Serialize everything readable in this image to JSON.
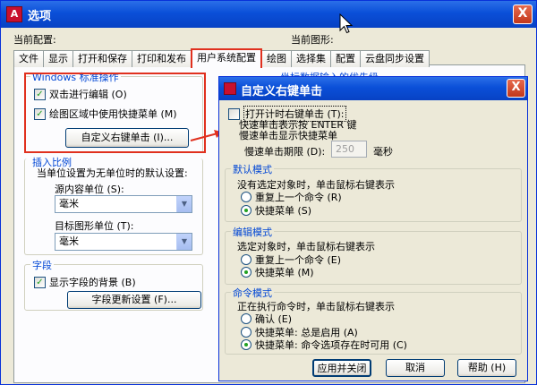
{
  "window": {
    "title": "选项",
    "close_label": "X",
    "app_icon_text": "A"
  },
  "profile": {
    "current_config_label": "当前配置:",
    "current_drawing_label": "当前图形:"
  },
  "tabs": [
    "文件",
    "显示",
    "打开和保存",
    "打印和发布",
    "用户系统配置",
    "绘图",
    "选择集",
    "配置",
    "云盘同步设置"
  ],
  "windows_group": {
    "title": "Windows 标准操作",
    "double_click_edit": "双击进行编辑 (O)",
    "shortcut_menu_in_drawing": "绘图区域中使用快捷菜单 (M)",
    "custom_right_click_button": "自定义右键单击 (I)..."
  },
  "insert_scale": {
    "title": "插入比例",
    "description": "当单位设置为无单位时的默认设置:",
    "source_units_label": "源内容单位 (S):",
    "source_units_value": "毫米",
    "target_units_label": "目标图形单位 (T):",
    "target_units_value": "毫米"
  },
  "fields": {
    "title": "字段",
    "show_background": "显示字段的背景 (B)",
    "update_settings_button": "字段更新设置 (F)..."
  },
  "background_text": "坐标数据输入的优先级",
  "dialog": {
    "title": "自定义右键单击",
    "close_label": "X",
    "timed_right_click": "打开计时右键单击 (T):",
    "quick_click_desc": "快速单击表示按 ENTER 键",
    "slow_click_desc": "慢速单击显示快捷菜单",
    "slow_click_limit_label": "慢速单击期限 (D):",
    "slow_click_limit_value": "250",
    "ms_unit": "毫秒",
    "default_mode": {
      "title": "默认模式",
      "desc": "没有选定对象时，单击鼠标右键表示",
      "repeat_last": "重复上一个命令 (R)",
      "shortcut_menu": "快捷菜单 (S)"
    },
    "edit_mode": {
      "title": "编辑模式",
      "desc": "选定对象时，单击鼠标右键表示",
      "repeat_last": "重复上一个命令 (E)",
      "shortcut_menu": "快捷菜单 (M)"
    },
    "command_mode": {
      "title": "命令模式",
      "desc": "正在执行命令时，单击鼠标右键表示",
      "confirm": "确认 (E)",
      "always_enabled": "快捷菜单: 总是启用 (A)",
      "when_options_present": "快捷菜单: 命令选项存在时可用 (C)"
    },
    "buttons": {
      "apply_close": "应用并关闭",
      "cancel": "取消",
      "help": "帮助 (H)"
    }
  },
  "colors": {
    "title_bar": "#0a4fd8",
    "highlight_red": "#e0301e",
    "group_title": "#0046d5"
  }
}
